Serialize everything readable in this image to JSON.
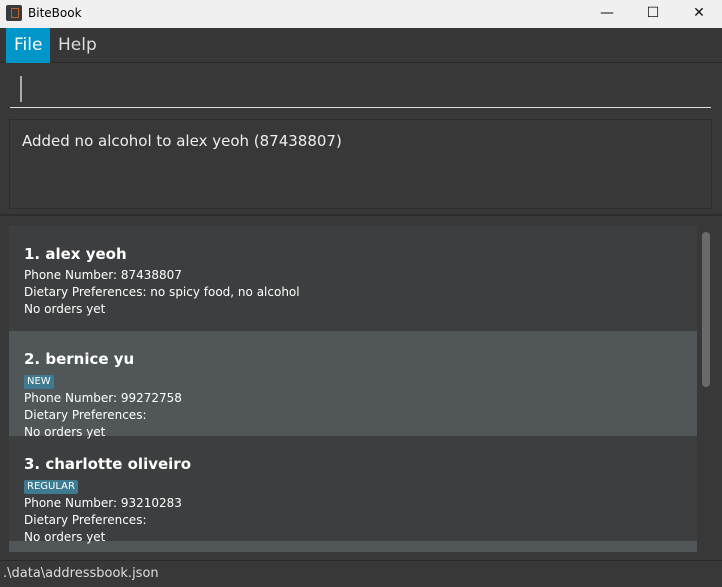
{
  "window": {
    "title": "BiteBook",
    "minimize": "—",
    "maximize": "☐",
    "close": "✕"
  },
  "menu": [
    {
      "label": "File",
      "active": true
    },
    {
      "label": "Help",
      "active": false
    }
  ],
  "command": {
    "value": ""
  },
  "result": "Added no alcohol to alex yeoh (87438807)",
  "persons": [
    {
      "name": "1. alex yeoh",
      "tag": "",
      "phone": "Phone Number: 87438807",
      "diet": "Dietary Preferences: no spicy food, no alcohol",
      "orders": "No orders yet"
    },
    {
      "name": "2. bernice yu",
      "tag": "NEW",
      "phone": "Phone Number: 99272758",
      "diet": "Dietary Preferences:",
      "orders": "No orders yet"
    },
    {
      "name": "3. charlotte oliveiro",
      "tag": "REGULAR",
      "phone": "Phone Number: 93210283",
      "diet": "Dietary Preferences:",
      "orders": "No orders yet"
    }
  ],
  "status": ".\\data\\addressbook.json",
  "colors": {
    "accent": "#0096c9",
    "tag": "#3e7b91"
  }
}
